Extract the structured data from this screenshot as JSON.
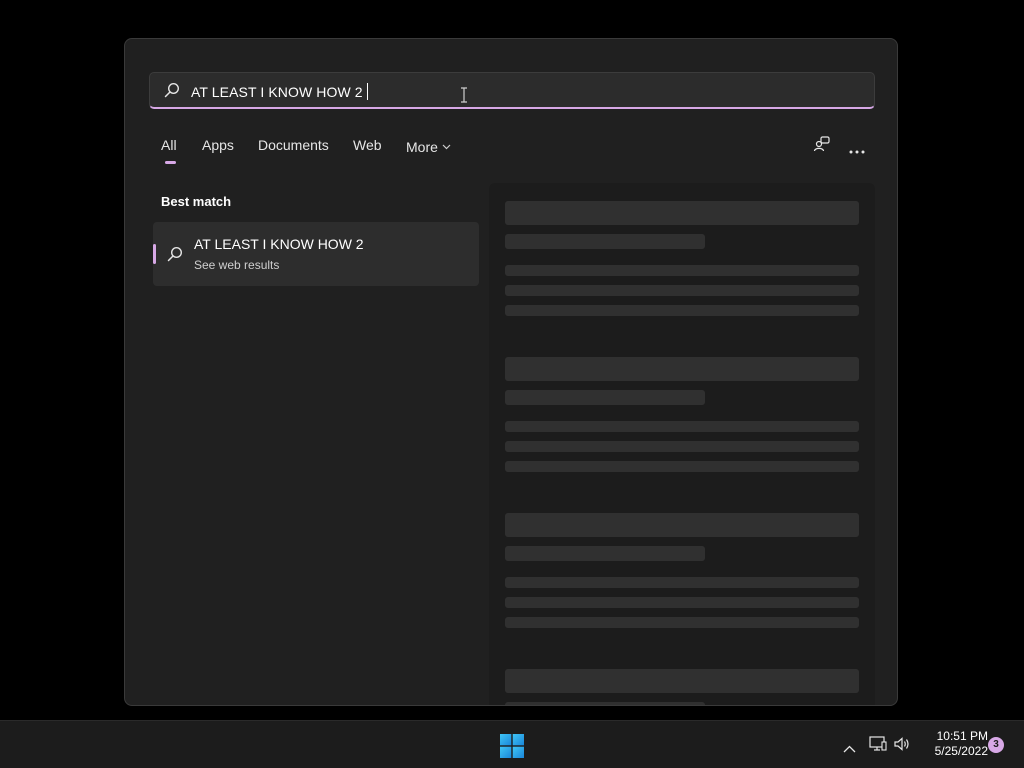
{
  "search": {
    "query": "AT LEAST I KNOW HOW 2",
    "accent_color": "#d7a8e6"
  },
  "tabs": [
    {
      "label": "All",
      "active": true
    },
    {
      "label": "Apps",
      "active": false
    },
    {
      "label": "Documents",
      "active": false
    },
    {
      "label": "Web",
      "active": false
    },
    {
      "label": "More",
      "active": false
    }
  ],
  "toolbar_icons": [
    "account-switch-icon",
    "more-options-icon"
  ],
  "results": {
    "section_title": "Best match",
    "best_match": {
      "title": "AT LEAST I KNOW HOW 2",
      "subtitle": "See web results",
      "icon": "search-icon"
    }
  },
  "preview": {
    "state": "loading-skeleton"
  },
  "taskbar": {
    "start_icon": "windows-start-icon",
    "tray_icons": [
      "show-hidden-icons-chevron",
      "network-icon",
      "volume-icon"
    ],
    "time": "10:51 PM",
    "date": "5/25/2022",
    "notification_count": "3"
  }
}
